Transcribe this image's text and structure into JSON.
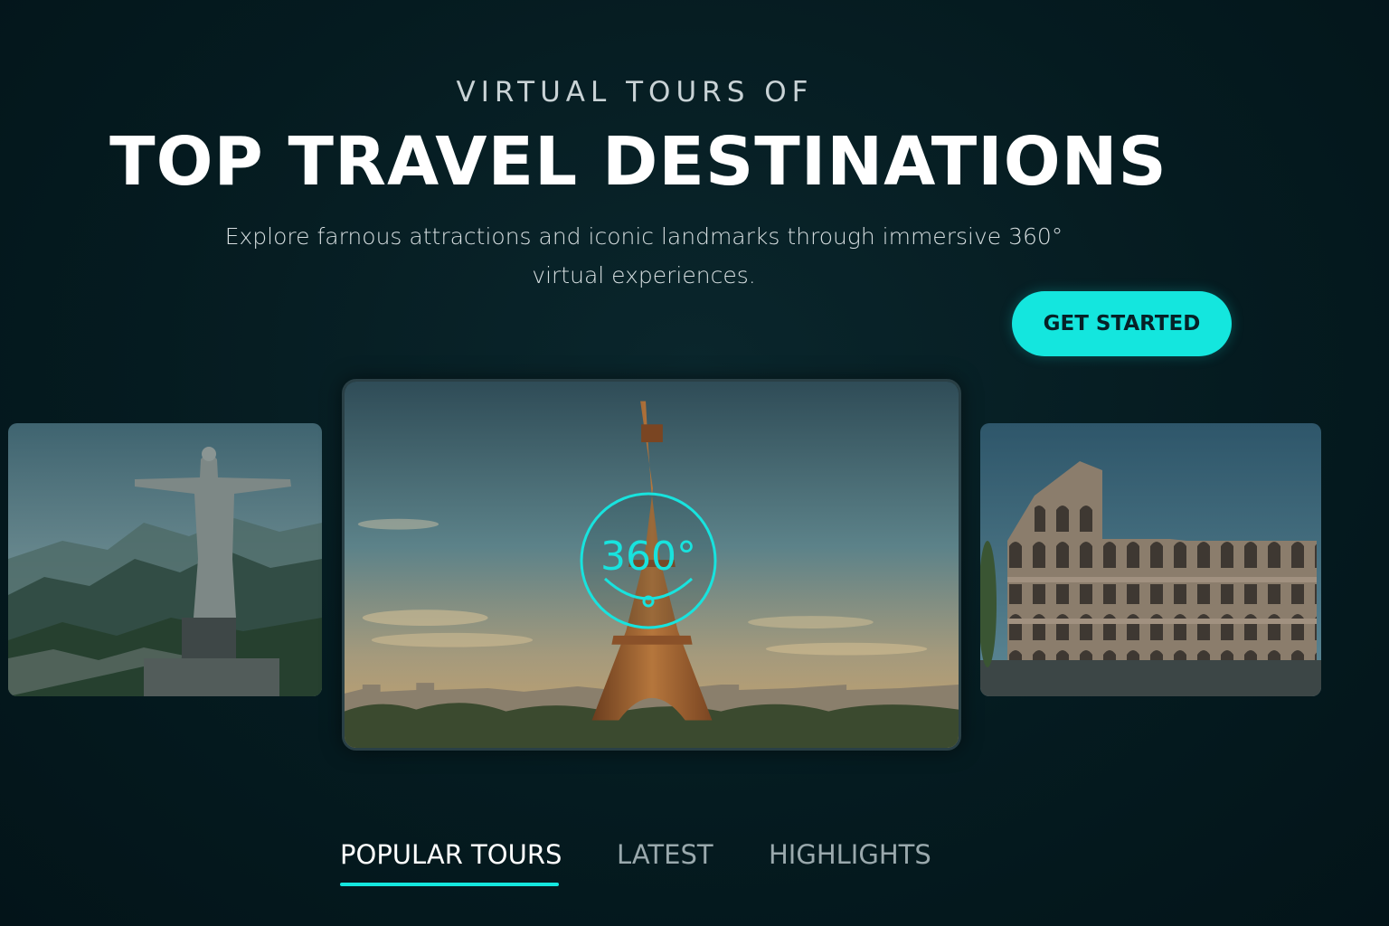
{
  "hero": {
    "eyebrow": "VIRTUAL TOURS OF",
    "title": "TOP TRAVEL DESTINATIONS",
    "subtitle": "Explore farnous attractions and iconic landmarks through immersive 360° virtual experiences.",
    "cta_label": "GET STARTED"
  },
  "carousel": {
    "badge_label": "360°",
    "items": [
      {
        "subject": "Christ the Redeemer statue"
      },
      {
        "subject": "Eiffel Tower"
      },
      {
        "subject": "Colosseum"
      }
    ]
  },
  "tabs": [
    {
      "label": "POPULAR TOURS",
      "active": true
    },
    {
      "label": "LATEST",
      "active": false
    },
    {
      "label": "HIGHLIGHTS",
      "active": false
    }
  ],
  "colors": {
    "accent": "#14e6de",
    "background": "#041a1f"
  }
}
